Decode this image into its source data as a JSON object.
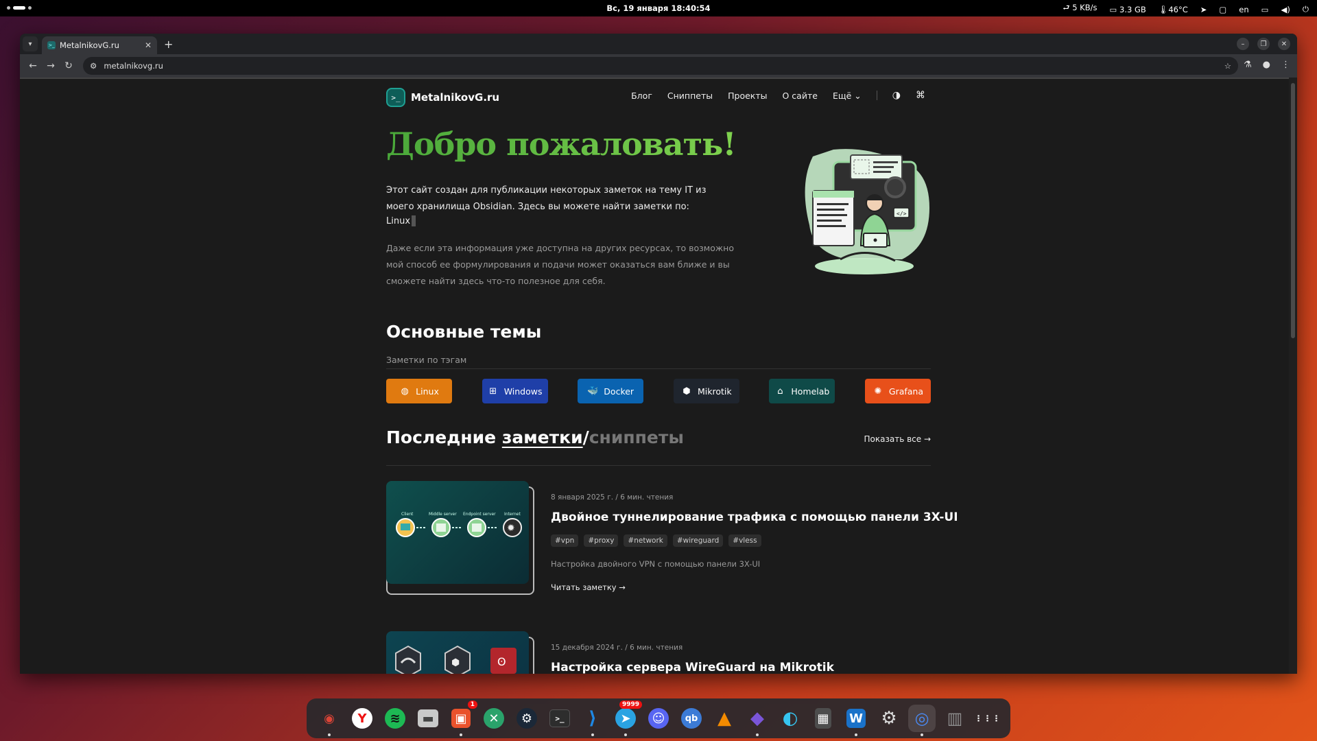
{
  "topbar": {
    "clock": "Вс, 19 января  18:40:54",
    "net": "⮐ 5 KB/s",
    "mem": "3.3 GB",
    "temp": "46°C",
    "lang": "en"
  },
  "browser": {
    "tab_title": "MetalnikovG.ru",
    "url": "metalnikovg.ru"
  },
  "site": {
    "logo_text": "MetalnikovG.ru",
    "nav": [
      "Блог",
      "Сниппеты",
      "Проекты",
      "О сайте",
      "Ещё"
    ],
    "hero_title": "Добро  пожаловать!",
    "intro": "Этот сайт создан для публикации некоторых заметок на тему IT из моего хранилища Obsidian. Здесь вы можете найти заметки по:",
    "typed": "Linux",
    "note": "Даже если эта информация уже доступна на других ресурсах, то возможно мой способ ее формулирования и подачи может оказаться вам ближе и вы сможете найти здесь что-то полезное для себя.",
    "topics_title": "Основные темы",
    "topics_sub": "Заметки по тэгам",
    "tags": [
      {
        "label": "Linux",
        "color": "#e07a10",
        "icon": "linux-icon"
      },
      {
        "label": "Windows",
        "color": "#1f3fa8",
        "icon": "windows-icon"
      },
      {
        "label": "Docker",
        "color": "#0a63b0",
        "icon": "docker-icon"
      },
      {
        "label": "Mikrotik",
        "color": "#1f252e",
        "icon": "mikrotik-icon"
      },
      {
        "label": "Homelab",
        "color": "#0f4a48",
        "icon": "homelab-icon"
      },
      {
        "label": "Grafana",
        "color": "#e8501a",
        "icon": "grafana-icon"
      }
    ],
    "recent_prefix": "Последние ",
    "recent_notes": "заметки",
    "recent_slash": "/",
    "recent_snippets": "сниппеты",
    "show_all": "Показать все →",
    "posts": [
      {
        "meta": "8 января 2025 г.  /  6 мин. чтения",
        "title": "Двойное туннелирование трафика с помощью панели 3X-UI",
        "tags": [
          "#vpn",
          "#proxy",
          "#network",
          "#wireguard",
          "#vless"
        ],
        "desc": "Настройка двойного VPN с помощью панели 3X-UI",
        "read": "Читать заметку →",
        "diagram": [
          "Client",
          "Middle server",
          "Endpoint server",
          "Internet"
        ]
      },
      {
        "meta": "15 декабря 2024 г.  /  6 мин. чтения",
        "title": "Настройка сервера WireGuard на Mikrotik"
      }
    ]
  },
  "dock": {
    "apps": [
      {
        "name": "chrome-icon",
        "glyph": "◉",
        "color": "#db4437"
      },
      {
        "name": "yandex-browser-icon",
        "glyph": "Y",
        "color": "#fff"
      },
      {
        "name": "spotify-icon",
        "glyph": "≋",
        "color": "#1db954"
      },
      {
        "name": "files-icon",
        "glyph": "▬",
        "color": "#c9c9c9"
      },
      {
        "name": "software-center-icon",
        "glyph": "▣",
        "color": "#e9522c",
        "badge": "1"
      },
      {
        "name": "remote-desktop-icon",
        "glyph": "✕",
        "color": "#2aa36b"
      },
      {
        "name": "steam-icon",
        "glyph": "⚙",
        "color": "#1b2838"
      },
      {
        "name": "terminal-icon",
        "glyph": ">_",
        "color": "#2d2d2d"
      },
      {
        "name": "vscode-icon",
        "glyph": "⟩",
        "color": "#1e88e5"
      },
      {
        "name": "telegram-icon",
        "glyph": "➤",
        "color": "#2aa3e2",
        "badge": "9999"
      },
      {
        "name": "discord-icon",
        "glyph": "☺",
        "color": "#5865f2"
      },
      {
        "name": "qbittorrent-icon",
        "glyph": "qb",
        "color": "#3c7bd6"
      },
      {
        "name": "vlc-icon",
        "glyph": "▲",
        "color": "#f48b00"
      },
      {
        "name": "obsidian-icon",
        "glyph": "◆",
        "color": "#7a55d8"
      },
      {
        "name": "color-picker-icon",
        "glyph": "◐",
        "color": "#36c5f0"
      },
      {
        "name": "calculator-icon",
        "glyph": "▦",
        "color": "#4d4d4d"
      },
      {
        "name": "writer-icon",
        "glyph": "W",
        "color": "#1a72c9"
      },
      {
        "name": "settings-icon",
        "glyph": "⚙",
        "color": "#555"
      },
      {
        "name": "chromium-icon",
        "glyph": "◎",
        "color": "#4a8af4"
      },
      {
        "name": "trash-icon",
        "glyph": "▥",
        "color": "#6d6d6d"
      },
      {
        "name": "app-grid-icon",
        "glyph": "⋮⋮⋮",
        "color": "transparent"
      }
    ]
  }
}
